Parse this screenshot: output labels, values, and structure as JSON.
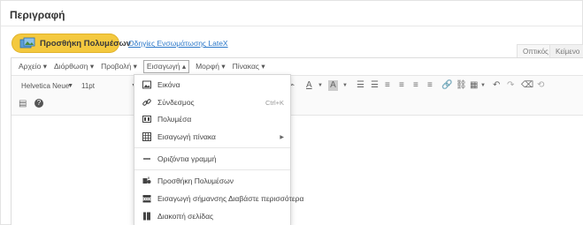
{
  "section": {
    "title": "Περιγραφή"
  },
  "media": {
    "add_label": "Προσθήκη Πολυμέσων",
    "guide_link": "Οδηγίες Ενσωμάτωσης LateX"
  },
  "tabs": {
    "visual": "Οπτικός",
    "text": "Κείμενο"
  },
  "menubar": [
    "Αρχείο ▾",
    "Διόρθωση ▾",
    "Προβολή ▾",
    "Εισαγωγή ▴",
    "Μορφή ▾",
    "Πίνακας ▾"
  ],
  "toolbar": {
    "font": "Helvetica Neue",
    "size": "11pt"
  },
  "insert_menu": {
    "items": [
      {
        "label": "Εικόνα",
        "icon": "image-icon"
      },
      {
        "label": "Σύνδεσμος",
        "icon": "link-icon",
        "shortcut": "Ctrl+K"
      },
      {
        "label": "Πολυμέσα",
        "icon": "media-icon"
      },
      {
        "label": "Εισαγωγή πίνακα",
        "icon": "table-icon",
        "submenu": true
      },
      {
        "label": "Οριζόντια γραμμή",
        "icon": "horizontal-line-icon"
      },
      {
        "label": "Προσθήκη Πολυμέσων",
        "icon": "add-media-icon"
      },
      {
        "label": "Εισαγωγή σήμανσης Διαβάστε περισσότερα",
        "icon": "read-more-icon"
      },
      {
        "label": "Διακοπή σελίδας",
        "icon": "page-break-icon"
      }
    ]
  },
  "colors": {
    "accent_button": "#f4c93f",
    "link": "#2a77c9"
  }
}
